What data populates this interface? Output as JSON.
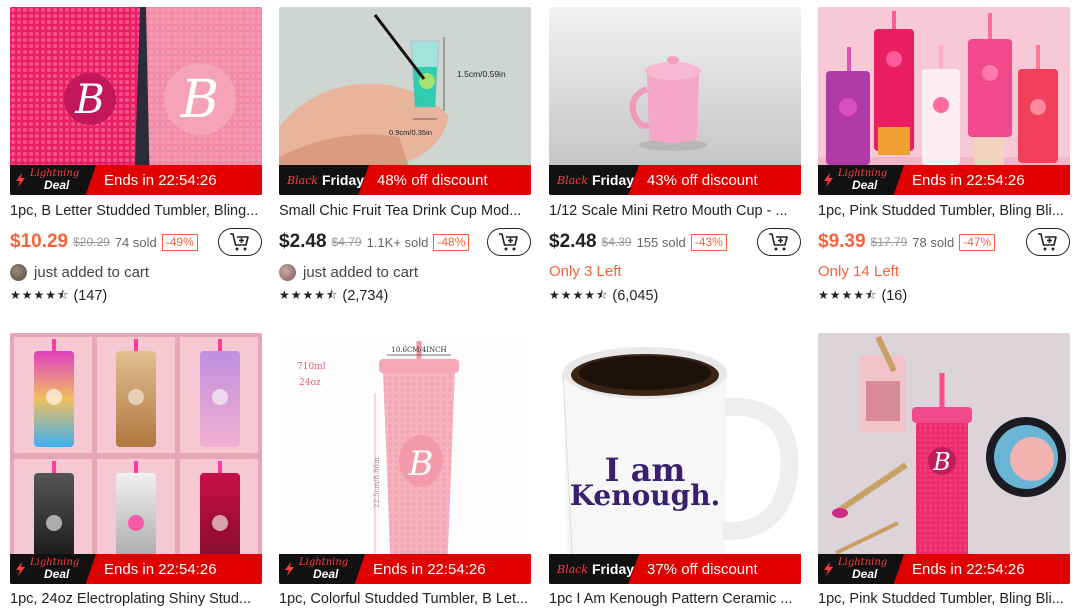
{
  "products": [
    {
      "title": "1pc, B Letter Studded Tumbler, Bling...",
      "banner": {
        "type": "lightning",
        "tag_top": "Lightning",
        "tag_bottom": "Deal",
        "text": "Ends in 22:54:26"
      },
      "price": "$10.29",
      "price_color": "#fa6338",
      "original_price": "$20.29",
      "sold": "74 sold",
      "discount": "-49%",
      "social": {
        "kind": "added",
        "text": "just added to cart"
      },
      "rating": {
        "stars": 4.5,
        "count": "(147)"
      },
      "image_icon": "pink-studded-tumblers"
    },
    {
      "title": "Small Chic Fruit Tea Drink Cup Mod...",
      "banner": {
        "type": "blackfriday",
        "tag_top": "Black",
        "tag_bottom": "Friday",
        "text": "48% off discount"
      },
      "price": "$2.48",
      "price_color": "#222222",
      "original_price": "$4.79",
      "sold": "1.1K+ sold",
      "discount": "-48%",
      "social": {
        "kind": "added",
        "text": "just added to cart"
      },
      "rating": {
        "stars": 4.5,
        "count": "(2,734)"
      },
      "image_icon": "mini-fruit-tea-cup",
      "image_labels": {
        "height": "1.5cm/0.59in",
        "width": "0.9cm/0.35in"
      }
    },
    {
      "title": "1/12 Scale Mini Retro Mouth Cup - ...",
      "banner": {
        "type": "blackfriday",
        "tag_top": "Black",
        "tag_bottom": "Friday",
        "text": "43% off discount"
      },
      "price": "$2.48",
      "price_color": "#222222",
      "original_price": "$4.39",
      "sold": "155 sold",
      "discount": "-43%",
      "social": {
        "kind": "stock",
        "text": "Only 3 Left"
      },
      "rating": {
        "stars": 4.5,
        "count": "(6,045)"
      },
      "image_icon": "mini-pink-mug"
    },
    {
      "title": "1pc, Pink Studded Tumbler, Bling Bli...",
      "banner": {
        "type": "lightning",
        "tag_top": "Lightning",
        "tag_bottom": "Deal",
        "text": "Ends in 22:54:26"
      },
      "price": "$9.39",
      "price_color": "#fa6338",
      "original_price": "$17.79",
      "sold": "78 sold",
      "discount": "-47%",
      "social": {
        "kind": "stock",
        "text": "Only 14 Left"
      },
      "rating": {
        "stars": 4.5,
        "count": "(16)"
      },
      "image_icon": "pink-tumbler-lineup"
    },
    {
      "title": "1pc, 24oz Electroplating Shiny Stud...",
      "banner": {
        "type": "lightning",
        "tag_top": "Lightning",
        "tag_bottom": "Deal",
        "text": "Ends in 22:54:26"
      },
      "image_icon": "electroplated-tumbler-grid"
    },
    {
      "title": "1pc, Colorful Studded Tumbler, B Let...",
      "banner": {
        "type": "lightning",
        "tag_top": "Lightning",
        "tag_bottom": "Deal",
        "text": "Ends in 22:54:26"
      },
      "image_icon": "pink-tumbler-dimensions",
      "image_labels": {
        "width": "10.6CM/4INCH",
        "volume": "710ml",
        "oz": "24oz",
        "height": "22.5cm/8.86in"
      }
    },
    {
      "title": "1pc I Am Kenough Pattern Ceramic ...",
      "banner": {
        "type": "blackfriday",
        "tag_top": "Black",
        "tag_bottom": "Friday",
        "text": "37% off discount"
      },
      "image_icon": "kenough-mug",
      "image_labels": {
        "line1": "I am",
        "line2": "Kenough."
      }
    },
    {
      "title": "1pc, Pink Studded Tumbler, Bling Bli...",
      "banner": {
        "type": "lightning",
        "tag_top": "Lightning",
        "tag_bottom": "Deal",
        "text": "Ends in 22:54:26"
      },
      "image_icon": "pink-tumbler-makeup"
    }
  ],
  "colors": {
    "accent": "#fa6338",
    "banner_red": "#e00000",
    "banner_tag": "#111111"
  }
}
